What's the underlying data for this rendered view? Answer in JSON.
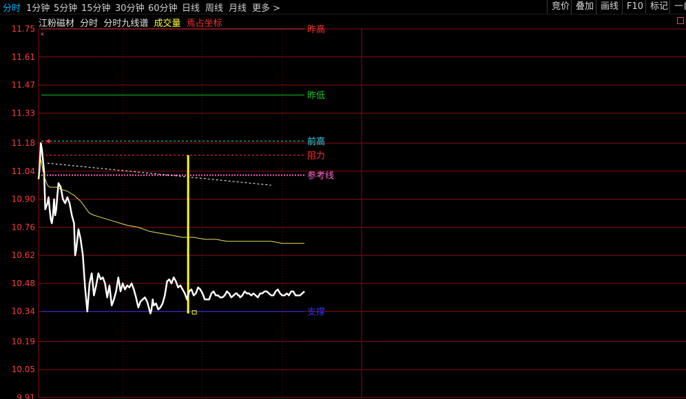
{
  "toolbar": {
    "periods": [
      "分时",
      "1分钟",
      "5分钟",
      "15分钟",
      "30分钟",
      "60分钟",
      "日线",
      "周线",
      "月线",
      "更多 >"
    ],
    "active_period": "分时",
    "tools": [
      "竞价",
      "叠加",
      "画线",
      "F10",
      "标记",
      "一自"
    ]
  },
  "subtitle": {
    "stock": "江粉磁材",
    "items": [
      "分时",
      "分时九线谱",
      "成交量",
      "焉占坐标"
    ]
  },
  "colors": {
    "background": "#000000",
    "grid": "#8a1010",
    "axis_text": "#ff3b3b",
    "price_line": "#ffffff",
    "avg_line": "#e6e65a",
    "yesterday_low": "#10d020",
    "prev_high": "#30d8e8",
    "resistance": "#ff3030",
    "reference": "#ff66cc",
    "support": "#3030ff",
    "volume_bar": "#ffff00"
  },
  "chart_data": {
    "type": "line",
    "y_ticks": [
      "11.75",
      "11.61",
      "11.47",
      "11.33",
      "11.18",
      "11.04",
      "10.90",
      "10.76",
      "10.62",
      "10.48",
      "10.34",
      "10.19",
      "10.05",
      "9.91"
    ],
    "ylim": [
      9.91,
      11.75
    ],
    "grid": true,
    "time_slots": 240,
    "series": [
      {
        "role": "price",
        "color": "#ffffff",
        "points": [
          [
            0,
            11.0
          ],
          [
            1,
            11.06
          ],
          [
            2,
            11.18
          ],
          [
            3,
            11.15
          ],
          [
            5,
            11.04
          ],
          [
            6,
            10.85
          ],
          [
            8,
            10.88
          ],
          [
            9,
            10.91
          ],
          [
            10,
            10.85
          ],
          [
            11,
            10.8
          ],
          [
            12,
            10.78
          ],
          [
            13,
            10.82
          ],
          [
            14,
            10.9
          ],
          [
            15,
            10.82
          ],
          [
            16,
            10.85
          ],
          [
            17,
            10.92
          ],
          [
            18,
            10.98
          ],
          [
            20,
            10.96
          ],
          [
            22,
            10.9
          ],
          [
            24,
            10.88
          ],
          [
            26,
            10.91
          ],
          [
            28,
            10.88
          ],
          [
            30,
            10.82
          ],
          [
            32,
            10.78
          ],
          [
            33,
            10.62
          ],
          [
            34,
            10.65
          ],
          [
            36,
            10.75
          ],
          [
            38,
            10.7
          ],
          [
            40,
            10.62
          ],
          [
            42,
            10.46
          ],
          [
            44,
            10.34
          ],
          [
            46,
            10.48
          ],
          [
            48,
            10.53
          ],
          [
            50,
            10.42
          ],
          [
            52,
            10.47
          ],
          [
            54,
            10.53
          ],
          [
            56,
            10.5
          ],
          [
            58,
            10.51
          ],
          [
            60,
            10.48
          ],
          [
            62,
            10.41
          ],
          [
            64,
            10.47
          ],
          [
            66,
            10.37
          ],
          [
            68,
            10.4
          ],
          [
            70,
            10.44
          ],
          [
            72,
            10.51
          ],
          [
            74,
            10.44
          ],
          [
            76,
            10.48
          ],
          [
            78,
            10.45
          ],
          [
            80,
            10.47
          ],
          [
            82,
            10.46
          ],
          [
            84,
            10.48
          ],
          [
            86,
            10.45
          ],
          [
            88,
            10.41
          ],
          [
            90,
            10.36
          ],
          [
            92,
            10.39
          ],
          [
            94,
            10.4
          ],
          [
            96,
            10.41
          ],
          [
            98,
            10.39
          ],
          [
            100,
            10.35
          ],
          [
            101,
            10.33
          ],
          [
            102,
            10.35
          ],
          [
            103,
            10.4
          ],
          [
            104,
            10.37
          ],
          [
            106,
            10.38
          ],
          [
            108,
            10.35
          ],
          [
            110,
            10.36
          ],
          [
            112,
            10.38
          ],
          [
            114,
            10.42
          ],
          [
            116,
            10.49
          ],
          [
            118,
            10.5
          ],
          [
            120,
            10.48
          ],
          [
            122,
            10.51
          ],
          [
            124,
            10.49
          ],
          [
            126,
            10.46
          ],
          [
            128,
            10.47
          ],
          [
            130,
            10.45
          ],
          [
            132,
            10.43
          ],
          [
            134,
            10.4
          ],
          [
            136,
            10.44
          ],
          [
            138,
            10.45
          ],
          [
            140,
            10.42
          ],
          [
            142,
            10.43
          ],
          [
            144,
            10.46
          ],
          [
            146,
            10.45
          ],
          [
            148,
            10.43
          ],
          [
            150,
            10.4
          ],
          [
            152,
            10.4
          ],
          [
            154,
            10.4
          ],
          [
            156,
            10.43
          ],
          [
            158,
            10.44
          ],
          [
            160,
            10.42
          ],
          [
            162,
            10.42
          ],
          [
            164,
            10.41
          ],
          [
            166,
            10.41
          ],
          [
            168,
            10.42
          ],
          [
            170,
            10.44
          ],
          [
            172,
            10.43
          ],
          [
            173,
            10.42
          ],
          [
            174,
            10.41
          ],
          [
            176,
            10.42
          ],
          [
            178,
            10.43
          ],
          [
            179,
            10.43
          ],
          [
            180,
            10.42
          ],
          [
            181,
            10.42
          ],
          [
            182,
            10.41
          ],
          [
            184,
            10.42
          ],
          [
            186,
            10.44
          ],
          [
            188,
            10.43
          ],
          [
            190,
            10.43
          ],
          [
            192,
            10.42
          ],
          [
            194,
            10.43
          ],
          [
            196,
            10.42
          ],
          [
            198,
            10.41
          ],
          [
            200,
            10.43
          ],
          [
            202,
            10.43
          ],
          [
            204,
            10.44
          ],
          [
            206,
            10.44
          ],
          [
            208,
            10.43
          ],
          [
            210,
            10.42
          ],
          [
            212,
            10.42
          ],
          [
            214,
            10.44
          ],
          [
            216,
            10.45
          ],
          [
            218,
            10.43
          ],
          [
            220,
            10.42
          ],
          [
            222,
            10.42
          ],
          [
            224,
            10.43
          ],
          [
            226,
            10.42
          ],
          [
            228,
            10.44
          ],
          [
            230,
            10.44
          ],
          [
            232,
            10.42
          ],
          [
            234,
            10.42
          ],
          [
            236,
            10.42
          ],
          [
            238,
            10.43
          ],
          [
            240,
            10.44
          ]
        ]
      },
      {
        "role": "average",
        "color": "#e6e65a",
        "points": [
          [
            0,
            11.0
          ],
          [
            2,
            11.1
          ],
          [
            4,
            11.04
          ],
          [
            6,
            11.0
          ],
          [
            8,
            10.97
          ],
          [
            10,
            10.96
          ],
          [
            12,
            10.96
          ],
          [
            16,
            10.96
          ],
          [
            20,
            10.95
          ],
          [
            26,
            10.94
          ],
          [
            32,
            10.92
          ],
          [
            34,
            10.91
          ],
          [
            38,
            10.89
          ],
          [
            42,
            10.86
          ],
          [
            46,
            10.83
          ],
          [
            50,
            10.82
          ],
          [
            56,
            10.81
          ],
          [
            62,
            10.8
          ],
          [
            68,
            10.79
          ],
          [
            74,
            10.78
          ],
          [
            80,
            10.77
          ],
          [
            90,
            10.76
          ],
          [
            100,
            10.74
          ],
          [
            110,
            10.73
          ],
          [
            120,
            10.72
          ],
          [
            130,
            10.71
          ],
          [
            140,
            10.71
          ],
          [
            150,
            10.7
          ],
          [
            160,
            10.7
          ],
          [
            170,
            10.69
          ],
          [
            180,
            10.69
          ],
          [
            190,
            10.69
          ],
          [
            200,
            10.69
          ],
          [
            210,
            10.69
          ],
          [
            220,
            10.68
          ],
          [
            230,
            10.68
          ],
          [
            240,
            10.68
          ]
        ]
      }
    ]
  },
  "levels": [
    {
      "label": "昨高",
      "value": 11.75,
      "color": "#ff3030",
      "style": "solid"
    },
    {
      "label": "昨低",
      "value": 11.42,
      "color": "#10d020",
      "style": "solid"
    },
    {
      "label": "前高",
      "value": 11.19,
      "color": "#30d8e8",
      "style": "dashed"
    },
    {
      "label": "阻力",
      "value": 11.12,
      "color": "#ff3030",
      "style": "dashed"
    },
    {
      "label": "参考线",
      "value": 11.02,
      "color": "#ff66cc",
      "style": "dotted"
    },
    {
      "label": "支撑",
      "value": 10.34,
      "color": "#3030ff",
      "style": "solid"
    }
  ],
  "trend_line": {
    "color": "#ffffff",
    "start": [
      8,
      11.08
    ],
    "end": [
      210,
      10.97
    ]
  },
  "volume_spike": {
    "slot": 135,
    "high": 11.12,
    "low": 10.33,
    "color": "#ffff00"
  }
}
